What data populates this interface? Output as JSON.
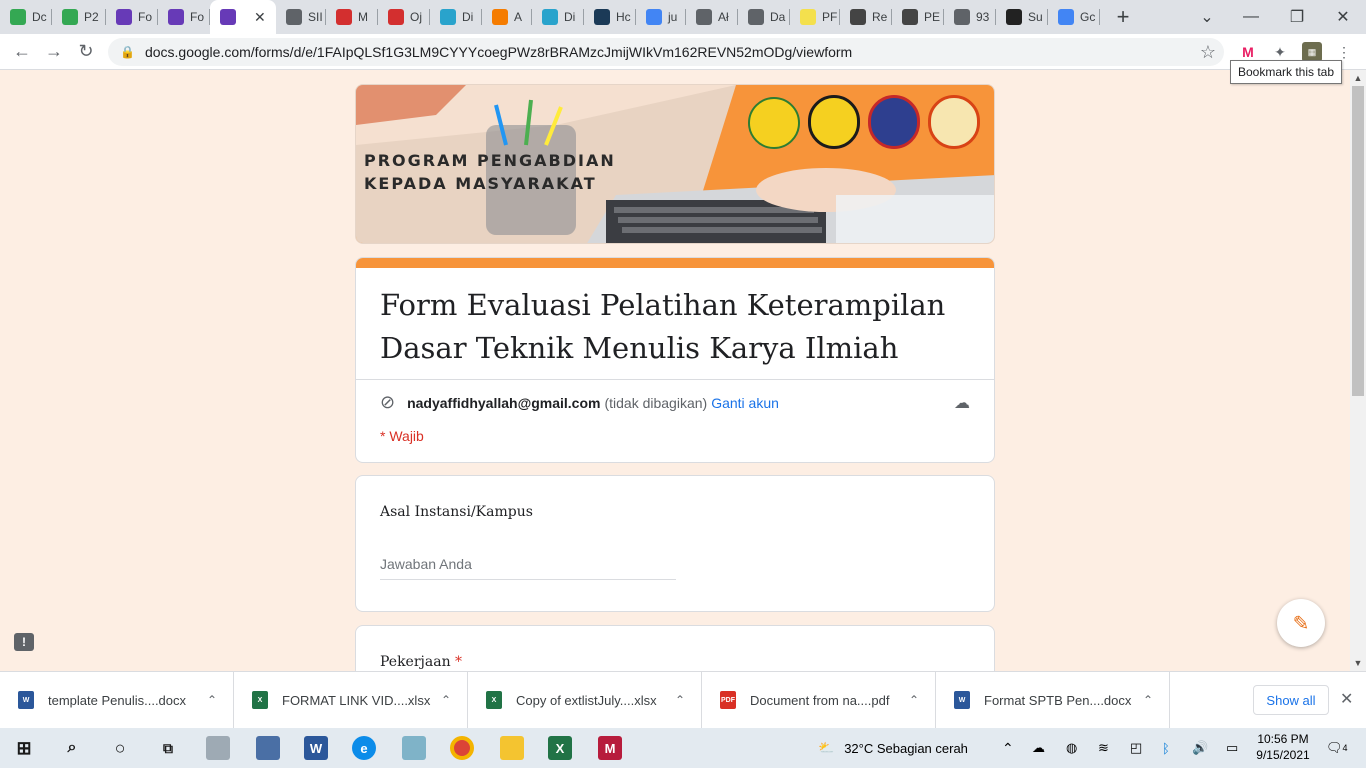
{
  "browser": {
    "tabs": [
      {
        "label": "Dc",
        "icon": "google-drive-icon",
        "color": "#34a853"
      },
      {
        "label": "P2",
        "icon": "google-drive-icon",
        "color": "#34a853"
      },
      {
        "label": "Fo",
        "icon": "google-forms-icon",
        "color": "#673ab7"
      },
      {
        "label": "Fo",
        "icon": "google-forms-icon",
        "color": "#673ab7"
      },
      {
        "label": "",
        "icon": "google-forms-icon",
        "color": "#673ab7",
        "active": true
      },
      {
        "label": "SII",
        "icon": "globe-icon",
        "color": "#5f6368"
      },
      {
        "label": "M",
        "icon": "iop-icon",
        "color": "#d32f2f"
      },
      {
        "label": "Oj",
        "icon": "iop-icon",
        "color": "#d32f2f"
      },
      {
        "label": "Di",
        "icon": "etu-icon",
        "color": "#29a3cc"
      },
      {
        "label": "A",
        "icon": "blogger-icon",
        "color": "#f57c00"
      },
      {
        "label": "Di",
        "icon": "etu-icon",
        "color": "#29a3cc"
      },
      {
        "label": "Hc",
        "icon": "b-icon",
        "color": "#1b3a57"
      },
      {
        "label": "ju",
        "icon": "google-icon",
        "color": "#4285f4"
      },
      {
        "label": "Ał",
        "icon": "globe-icon",
        "color": "#5f6368"
      },
      {
        "label": "Da",
        "icon": "globe-icon",
        "color": "#5f6368"
      },
      {
        "label": "PF",
        "icon": "yellow-circle-icon",
        "color": "#f4e04d"
      },
      {
        "label": "Re",
        "icon": "journal-icon",
        "color": "#444444"
      },
      {
        "label": "PE",
        "icon": "journal-icon",
        "color": "#444444"
      },
      {
        "label": "93",
        "icon": "globe-icon",
        "color": "#5f6368"
      },
      {
        "label": "Su",
        "icon": "pkp-icon",
        "color": "#222222"
      },
      {
        "label": "Gc",
        "icon": "google-translate-icon",
        "color": "#4285f4"
      }
    ],
    "new_tab": "+",
    "url": "docs.google.com/forms/d/e/1FAIpQLSf1G3LM9CYYYcoegPWz8rBRAMzcJmijWIkVm162REVN52mODg/viewform",
    "tooltip": "Bookmark this tab"
  },
  "form": {
    "banner_text_line1": "PROGRAM PENGABDIAN",
    "banner_text_line2": "KEPADA MASYARAKAT",
    "title": "Form Evaluasi Pelatihan Keterampilan Dasar Teknik Menulis Karya Ilmiah",
    "email": "nadyaffidhyallah@gmail.com",
    "not_shared": "(tidak dibagikan)",
    "switch_account": "Ganti akun",
    "required_note": "* Wajib",
    "accent_color": "#f7943a",
    "questions": [
      {
        "label": "Asal Instansi/Kampus",
        "placeholder": "Jawaban Anda",
        "required": false
      },
      {
        "label": "Pekerjaan",
        "required": true,
        "required_mark": "*"
      }
    ]
  },
  "downloads": {
    "items": [
      {
        "name": "template Penulis....docx",
        "type": "word"
      },
      {
        "name": "FORMAT LINK VID....xlsx",
        "type": "excel"
      },
      {
        "name": "Copy of extlistJuly....xlsx",
        "type": "excel"
      },
      {
        "name": "Document from na....pdf",
        "type": "pdf"
      },
      {
        "name": "Format SPTB Pen....docx",
        "type": "word"
      }
    ],
    "show_all": "Show all"
  },
  "taskbar": {
    "weather": "32°C  Sebagian cerah",
    "time": "10:56 PM",
    "date": "9/15/2021",
    "notification_count": "4"
  }
}
